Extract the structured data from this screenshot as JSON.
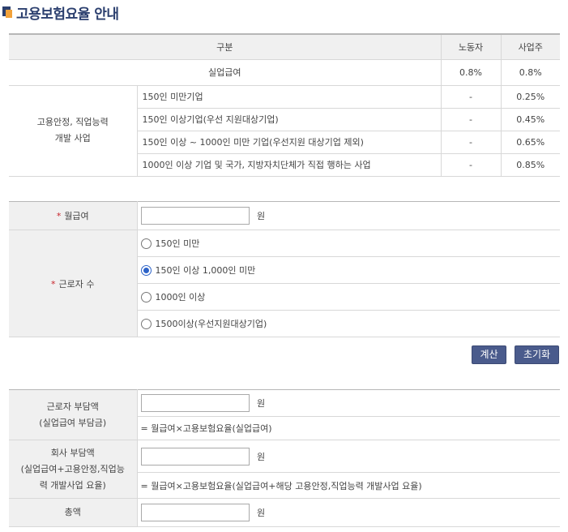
{
  "page": {
    "title": "고용보험요율 안내"
  },
  "rate_table": {
    "headers": {
      "category": "구분",
      "worker": "노동자",
      "employer": "사업주"
    },
    "base_row": {
      "label": "실업급여",
      "worker": "0.8%",
      "employer": "0.8%"
    },
    "group_label": "고용안정, 직업능력 개발 사업",
    "group_label_lines": [
      "고용안정, 직업능력",
      "개발 사업"
    ],
    "rows": [
      {
        "label": "150인 미만기업",
        "worker": "-",
        "employer": "0.25%"
      },
      {
        "label": "150인 이상기업(우선 지원대상기업)",
        "worker": "-",
        "employer": "0.45%"
      },
      {
        "label": "150인 이상 ~ 1000인 미만 기업(우선지원 대상기업 제외)",
        "worker": "-",
        "employer": "0.65%"
      },
      {
        "label": "1000인 이상 기업 및 국가, 지방자치단체가 직접 행하는 사업",
        "worker": "-",
        "employer": "0.85%"
      }
    ]
  },
  "form": {
    "monthly_pay": {
      "label": "월급여",
      "value": "",
      "unit": "원"
    },
    "worker_count": {
      "label": "근로자 수",
      "options": [
        {
          "label": "150인 미만",
          "checked": false
        },
        {
          "label": "150인 이상 1,000인 미만",
          "checked": true
        },
        {
          "label": "1000인 이상",
          "checked": false
        },
        {
          "label": "1500이상(우선지원대상기업)",
          "checked": false
        }
      ]
    },
    "calc_button": "계산",
    "reset_button": "초기화"
  },
  "results": {
    "worker_share": {
      "label_lines": [
        "근로자 부담액",
        "(실업급여 부담금)"
      ],
      "value": "",
      "unit": "원",
      "formula": "= 월급여×고용보험요율(실업급여)"
    },
    "company_share": {
      "label_lines": [
        "회사 부담액",
        "(실업급여+고용안정,직업능",
        "력 개발사업 요율)"
      ],
      "value": "",
      "unit": "원",
      "formula": "= 월급여×고용보험요율(실업급여+해당 고용안정,직업능력 개발사업 요율)"
    },
    "total": {
      "label": "총액",
      "value": "",
      "unit": "원"
    }
  },
  "colors": {
    "title": "#2b3f6e",
    "button": "#4a5b8c",
    "required_star": "#c8242b",
    "header_bg": "#f0f0f0"
  }
}
